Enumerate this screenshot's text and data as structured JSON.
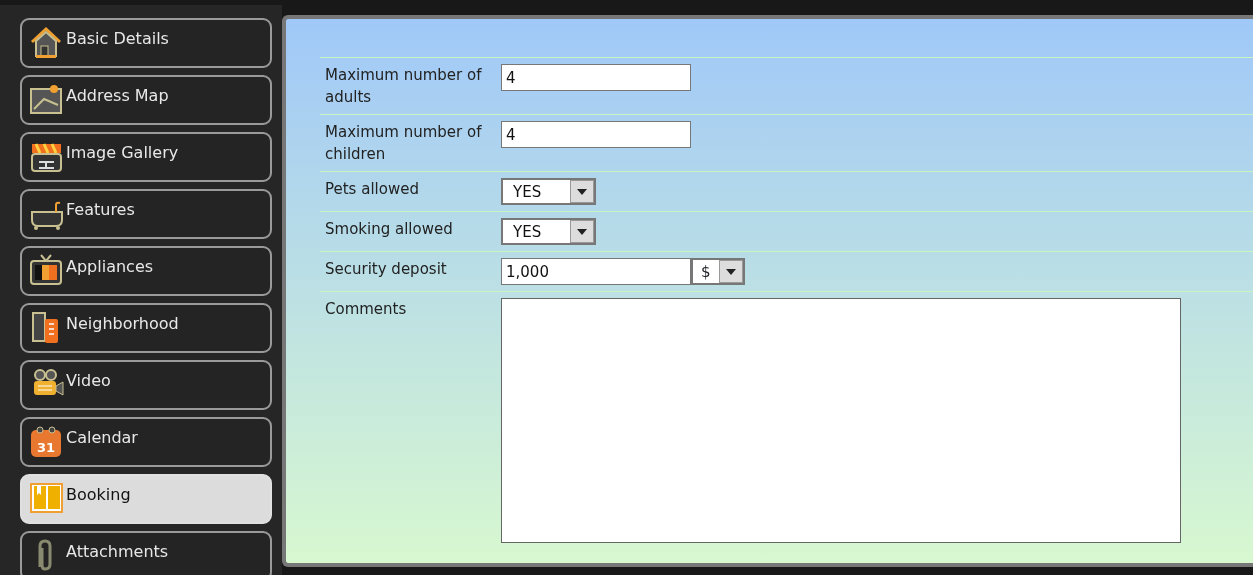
{
  "sidebar": {
    "items": [
      {
        "label": "Basic Details",
        "selected": false
      },
      {
        "label": "Address Map",
        "selected": false
      },
      {
        "label": "Image Gallery",
        "selected": false
      },
      {
        "label": "Features",
        "selected": false
      },
      {
        "label": "Appliances",
        "selected": false
      },
      {
        "label": "Neighborhood",
        "selected": false
      },
      {
        "label": "Video",
        "selected": false
      },
      {
        "label": "Calendar",
        "selected": false,
        "icon_text": "31"
      },
      {
        "label": "Booking",
        "selected": true
      },
      {
        "label": "Attachments",
        "selected": false
      }
    ]
  },
  "form": {
    "fields": [
      {
        "kind": "text",
        "label": "Maximum number of adults",
        "value": "4"
      },
      {
        "kind": "text",
        "label": "Maximum number of children",
        "value": "4"
      },
      {
        "kind": "select",
        "label": "Pets allowed",
        "value": "YES"
      },
      {
        "kind": "select",
        "label": "Smoking allowed",
        "value": "YES"
      },
      {
        "kind": "currency",
        "label": "Security deposit",
        "value": "1,000",
        "currency": "$"
      },
      {
        "kind": "textarea",
        "label": "Comments"
      }
    ]
  }
}
